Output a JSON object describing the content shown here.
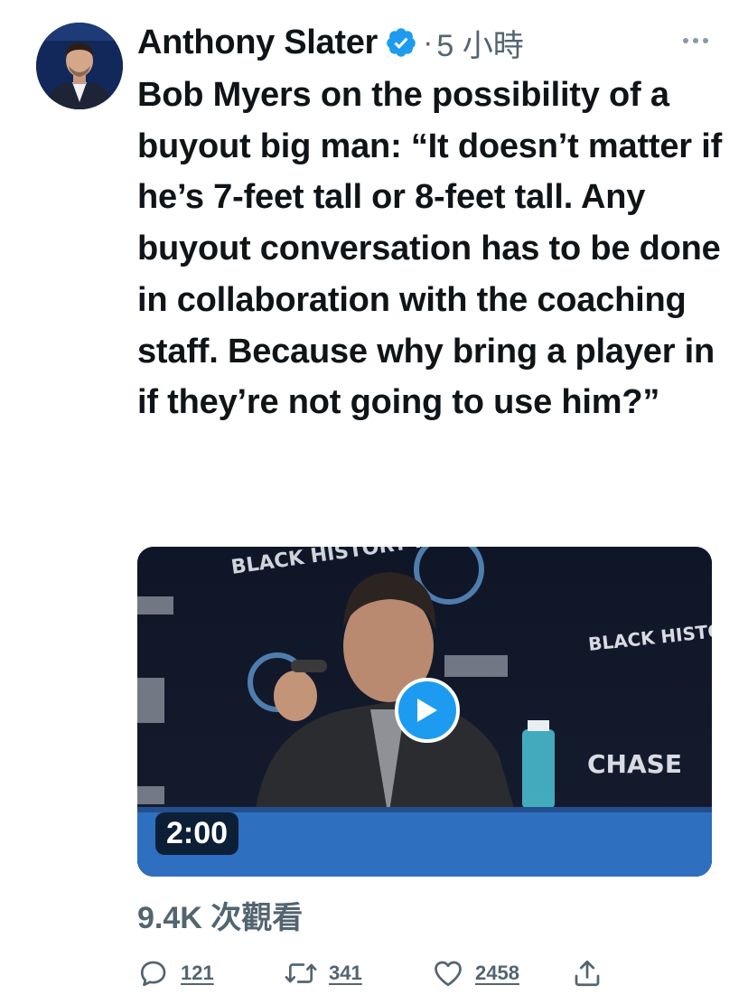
{
  "tweet": {
    "author": {
      "display_name": "Anthony Slater",
      "verified": true,
      "avatar_icon": "avatar-photo"
    },
    "separator": "·",
    "timestamp": "5 小時",
    "more_icon": "more-horizontal-icon",
    "text": "Bob Myers on the possibility of a buyout big man: “It doesn’t matter if he’s 7-feet tall or 8-feet tall. Any buyout conversation has to be done in collaboration with the coaching staff. Because why bring a player in if they’re not going to use him?”",
    "media": {
      "type": "video",
      "duration": "2:00",
      "banner_text": "BLACK HISTORY MONTH",
      "sponsor_text": "CHASE"
    },
    "views": "9.4K 次觀看",
    "actions": {
      "reply": {
        "icon": "reply-icon",
        "count": "121"
      },
      "retweet": {
        "icon": "retweet-icon",
        "count": "341"
      },
      "like": {
        "icon": "heart-icon",
        "count": "2458"
      },
      "share": {
        "icon": "share-icon"
      }
    }
  },
  "colors": {
    "text_primary": "#0f1419",
    "text_secondary": "#536471",
    "accent": "#1d9bf0"
  }
}
